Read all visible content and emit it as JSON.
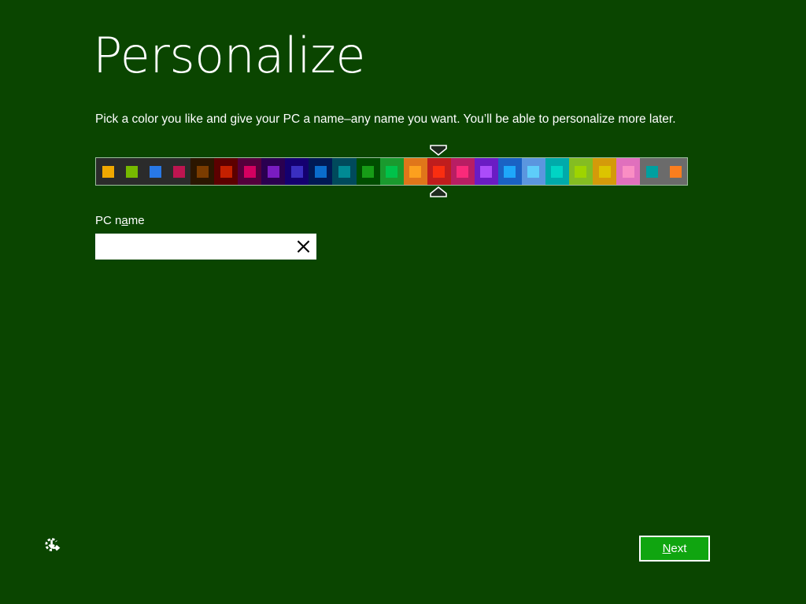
{
  "page": {
    "title": "Personalize",
    "subtitle": "Pick a color you like and give your PC a name–any name you want. You’ll be able to personalize more later.",
    "background_color": "#0a4500"
  },
  "color_picker": {
    "name": "accent-color-strip",
    "selected_index": 14,
    "selected_cell_color": "#004d00",
    "selected_swatch_color": "#179c17",
    "swatches": [
      {
        "index": 0,
        "cell": "#2b2b2b",
        "swatch": "#f0a800"
      },
      {
        "index": 1,
        "cell": "#2b2b2b",
        "swatch": "#76b900"
      },
      {
        "index": 2,
        "cell": "#2b2b2b",
        "swatch": "#2878e6"
      },
      {
        "index": 3,
        "cell": "#2b2b2b",
        "swatch": "#bd1550"
      },
      {
        "index": 4,
        "cell": "#2b1600",
        "swatch": "#7a3c00"
      },
      {
        "index": 5,
        "cell": "#5c0000",
        "swatch": "#c42000"
      },
      {
        "index": 6,
        "cell": "#54003c",
        "swatch": "#d40060"
      },
      {
        "index": 7,
        "cell": "#2a0050",
        "swatch": "#7a1cc0"
      },
      {
        "index": 8,
        "cell": "#140070",
        "swatch": "#3a2ec0"
      },
      {
        "index": 9,
        "cell": "#001a55",
        "swatch": "#0a6ccc"
      },
      {
        "index": 10,
        "cell": "#004a5c",
        "swatch": "#008a94"
      },
      {
        "index": 11,
        "cell": "#004d00",
        "swatch": "#179c17"
      },
      {
        "index": 12,
        "cell": "#1a9a2e",
        "swatch": "#00c24a"
      },
      {
        "index": 13,
        "cell": "#e0761a",
        "swatch": "#fca01e"
      },
      {
        "index": 14,
        "cell": "#bf1d1d",
        "swatch": "#f92e10"
      },
      {
        "index": 15,
        "cell": "#b81e63",
        "swatch": "#fa2a7a"
      },
      {
        "index": 16,
        "cell": "#6a1cc4",
        "swatch": "#ab4cfa"
      },
      {
        "index": 17,
        "cell": "#1a62c4",
        "swatch": "#1ea8fa"
      },
      {
        "index": 18,
        "cell": "#5b96df",
        "swatch": "#5ecdfa"
      },
      {
        "index": 19,
        "cell": "#00aaaa",
        "swatch": "#00d4c4"
      },
      {
        "index": 20,
        "cell": "#84bd22",
        "swatch": "#9ed400"
      },
      {
        "index": 21,
        "cell": "#d49a0a",
        "swatch": "#dcc400"
      },
      {
        "index": 22,
        "cell": "#e070bd",
        "swatch": "#fa8ec4"
      },
      {
        "index": 23,
        "cell": "#6b6b6b",
        "swatch": "#00a0a0"
      },
      {
        "index": 24,
        "cell": "#6b6b6b",
        "swatch": "#fa7e1e"
      }
    ]
  },
  "pc_name": {
    "label_before": "PC n",
    "label_accel": "a",
    "label_after": "me",
    "value": "",
    "placeholder": "",
    "clear_icon": "close-x-icon"
  },
  "footer": {
    "ease_of_access_icon": "ease-of-access-icon",
    "next_accel": "N",
    "next_rest": "ext",
    "next_color": "#10a510"
  }
}
